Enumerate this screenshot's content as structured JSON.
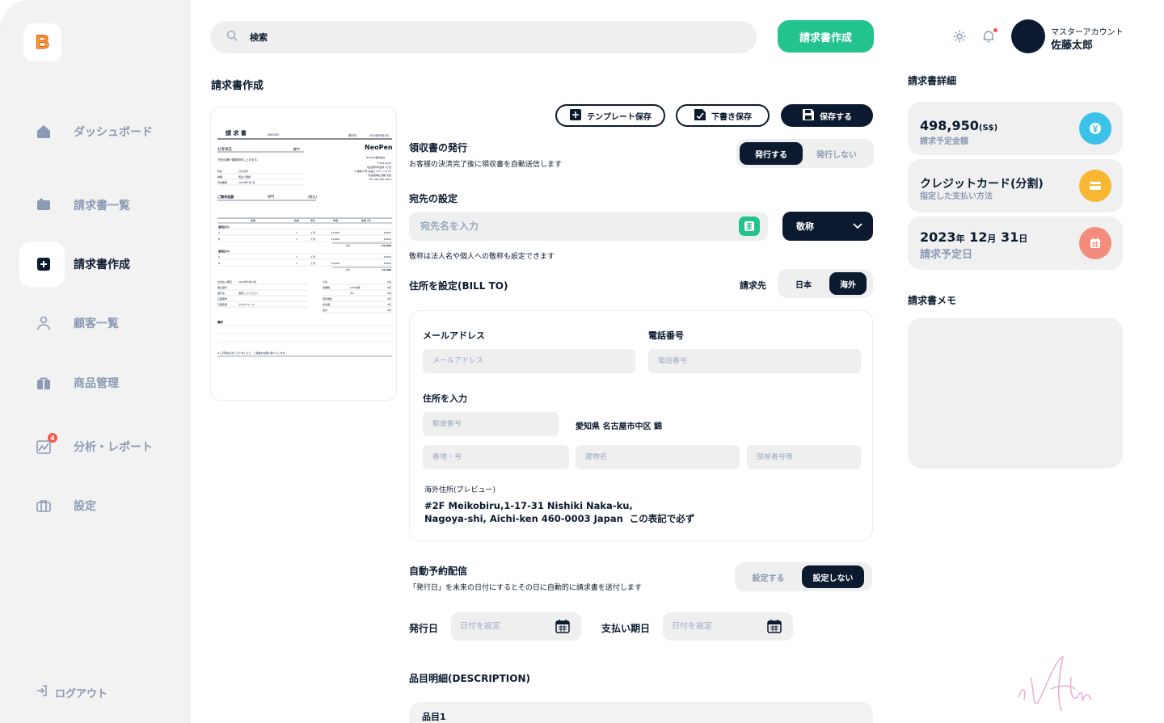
{
  "app": {
    "logo_letter": "B",
    "brand_colors": {
      "accent": "#22c38e",
      "dark": "#0b1a2e",
      "muted": "#8b9bb3"
    }
  },
  "sidebar": {
    "items": [
      {
        "label": "ダッシュボード",
        "icon": "home-icon"
      },
      {
        "label": "請求書一覧",
        "icon": "folder-icon"
      },
      {
        "label": "請求書作成",
        "icon": "add-document-icon",
        "active": true
      },
      {
        "label": "顧客一覧",
        "icon": "user-icon"
      },
      {
        "label": "商品管理",
        "icon": "gift-icon"
      },
      {
        "label": "分析・レポート",
        "icon": "chart-icon",
        "badge": "4"
      },
      {
        "label": "設定",
        "icon": "briefcase-icon"
      }
    ],
    "logout": "ログアウト"
  },
  "header": {
    "search_placeholder": "検索",
    "create_button": "請求書作成",
    "account_role": "マスターアカウント",
    "account_name": "佐藤太郎"
  },
  "main": {
    "title": "請求書作成",
    "buttons": {
      "template_save": "テンプレート保存",
      "draft_save": "下書き保存",
      "save": "保存する"
    },
    "receipt": {
      "title": "領収書の発行",
      "desc": "お客様の決済完了後に領収書を自動送信します",
      "options": [
        "発行する",
        "発行しない"
      ]
    },
    "recipient": {
      "title": "宛先の設定",
      "placeholder": "宛先名を入力",
      "honorific": "敬称",
      "note": "敬称は法人名や個人への敬称も設定できます"
    },
    "address": {
      "title": "住所を設定(BILL TO)",
      "billing_label": "請求先",
      "options": [
        "日本",
        "海外"
      ],
      "email_label": "メールアドレス",
      "email_placeholder": "メールアドレス",
      "phone_label": "電話番号",
      "phone_placeholder": "電話番号",
      "address_label": "住所を入力",
      "postal_placeholder": "郵便番号",
      "prefecture_text": "愛知県 名古屋市中区 錦",
      "street_placeholder": "番地・号",
      "building_placeholder": "建物名",
      "room_placeholder": "部屋番号等",
      "preview_label": "海外住所(プレビュー)",
      "preview_line1": "#2F Meikobiru,1-17-31 Nishiki Naka-ku,",
      "preview_line2": "Nagoya-shi, Aichi-ken 460-0003 Japan  この表記で必ず"
    },
    "auto_delivery": {
      "title": "自動予約配信",
      "desc": "「発行日」を未来の日付にするとその日に自動的に請求書を送付します",
      "options": [
        "設定する",
        "設定しない"
      ]
    },
    "dates": {
      "issue_label": "発行日",
      "issue_placeholder": "日付を設定",
      "due_label": "支払い期日",
      "due_placeholder": "日付を設定"
    },
    "description": {
      "title": "品目明細(DESCRIPTION)",
      "item1": "品目1"
    }
  },
  "invoice_preview": {
    "heading": "請 求 書",
    "heading_en": "INVOICE",
    "issue_label": "発行日",
    "issue_date": "2024年8月1日",
    "customer": "お客様名",
    "honor": "御中",
    "intro": "下記の通り御請求申し上げます。",
    "company": "NeoPen",
    "company_sub": "NeoPen株式会社",
    "addr_lines": [
      "〒460-0003",
      "名古屋市中区錦 1丁目",
      "17番地31号 名鉄ビルディング 2F",
      "代表取締役 佐藤 太郎",
      "TEL 052-990-2921"
    ],
    "info_rows": [
      [
        "件名",
        "〇〇の件"
      ],
      [
        "納期",
        "別途ご相談"
      ],
      [
        "有効期限",
        "2024年7月1日"
      ]
    ],
    "total_label": "ご請求金額",
    "total_value": "0円",
    "tax_note": "(税込)",
    "table_headers": [
      "摘要",
      "数量",
      "単位",
      "単価",
      "金額 (円)"
    ],
    "groups": [
      {
        "name": "業務区分1",
        "rows": [
          [
            "A",
            "1",
            "ヶ月",
            "10,000",
            "10000"
          ],
          [
            "B",
            "1",
            "ヶ月",
            "10,000",
            "10000"
          ]
        ],
        "subtotal": "20,000"
      },
      {
        "name": "業務区分2",
        "rows": [
          [
            "A",
            "1",
            "ヶ月",
            "",
            "10000"
          ],
          [
            "B",
            "1",
            "ヶ月",
            "10,000",
            "10000"
          ]
        ],
        "subtotal": "10,000"
      }
    ],
    "footer_left": [
      [
        "お支払い期日",
        "2024年7月10日"
      ],
      [
        "振込銀行",
        ""
      ],
      [
        "銀行名",
        "選択してください"
      ],
      [
        "口座番号",
        ""
      ],
      [
        "口座名義",
        "カ)ネオペン (ｶ"
      ]
    ],
    "footer_right": [
      [
        "小計",
        "0円"
      ],
      [
        "消費税",
        "10%対象",
        "0円"
      ],
      [
        "",
        "8%",
        "0円"
      ],
      [
        "源泉徴収",
        "0円"
      ],
      [
        "支払額",
        "0円"
      ],
      [
        "合計",
        "0円"
      ]
    ],
    "memo_label": "備考",
    "footnote": "※ご不明な点がございましたら、ご連絡をお願い致いたします。"
  },
  "details": {
    "title": "請求書詳細",
    "amount": "498,950",
    "amount_unit": "(S$)",
    "amount_label": "請求予定金額",
    "method": "クレジットカード(分割)",
    "method_label": "指定した支払い方法",
    "date_year": "2023",
    "date_year_unit": "年",
    "date_month": "12",
    "date_month_unit": "月",
    "date_day": "31",
    "date_day_unit": "日",
    "date_label": "請求予定日",
    "colors": {
      "amount": "#3cc2e8",
      "method": "#f7b733",
      "date": "#f28c7c"
    }
  },
  "memo": {
    "title": "請求書メモ"
  }
}
